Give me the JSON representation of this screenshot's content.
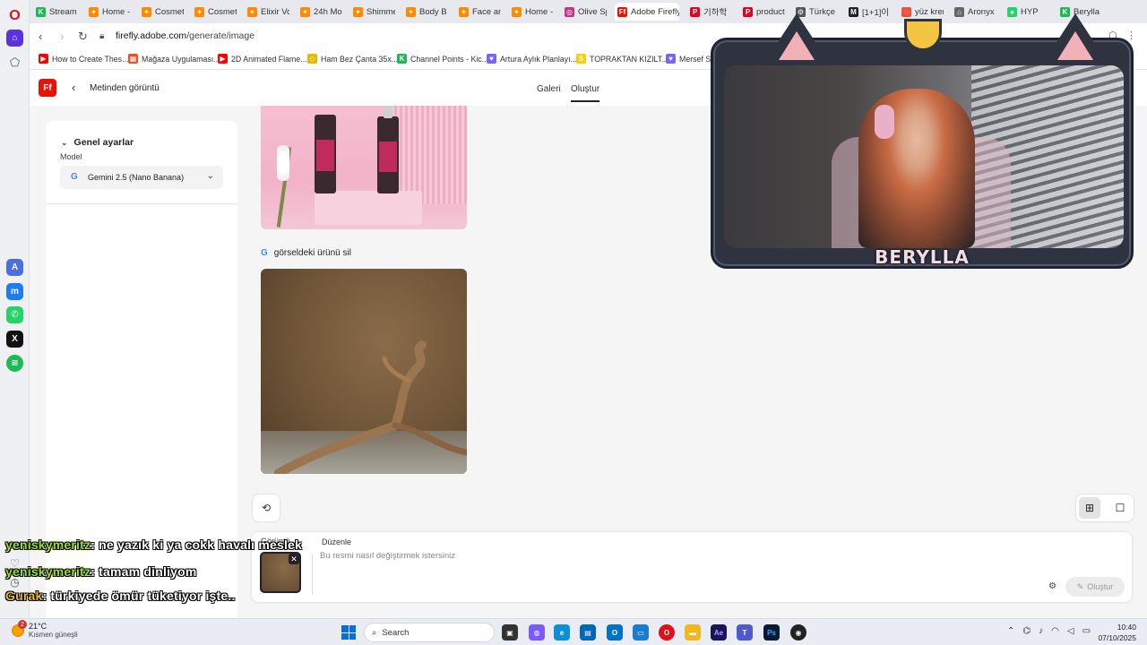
{
  "browser": {
    "url_host": "firefly.adobe.com",
    "url_path": "/generate/image",
    "tabs": [
      {
        "label": "Stream",
        "color": "#1db954",
        "icon": "K"
      },
      {
        "label": "Home -",
        "color": "#ff8a00",
        "icon": "✦"
      },
      {
        "label": "Cosmet",
        "color": "#ff8a00",
        "icon": "✦"
      },
      {
        "label": "Cosmeti",
        "color": "#ff8a00",
        "icon": "✦"
      },
      {
        "label": "Elixir Vo",
        "color": "#ff8a00",
        "icon": "✦"
      },
      {
        "label": "24h Mo",
        "color": "#ff8a00",
        "icon": "✦"
      },
      {
        "label": "Shimme",
        "color": "#ff8a00",
        "icon": "✦"
      },
      {
        "label": "Body B",
        "color": "#ff8a00",
        "icon": "✦"
      },
      {
        "label": "Face anc",
        "color": "#ff8a00",
        "icon": "✦"
      },
      {
        "label": "Home -",
        "color": "#ff8a00",
        "icon": "✦"
      },
      {
        "label": "Olive Sp",
        "color": "#c13584",
        "icon": "◎"
      },
      {
        "label": "Adobe Firefly",
        "color": "#eb1000",
        "icon": "Ff"
      },
      {
        "label": "기하학",
        "color": "#e60023",
        "icon": "P"
      },
      {
        "label": "product",
        "color": "#e60023",
        "icon": "P"
      },
      {
        "label": "Türkçe",
        "color": "#555555",
        "icon": "⚙"
      },
      {
        "label": "[1+1]이",
        "color": "#222222",
        "icon": "M"
      },
      {
        "label": "yüz krem",
        "color": "#e8533a",
        "icon": "◌"
      },
      {
        "label": "Aronyx",
        "color": "#666666",
        "icon": "⌂"
      },
      {
        "label": "HYP",
        "color": "#25d366",
        "icon": "●"
      },
      {
        "label": "Berylla",
        "color": "#1db954",
        "icon": "K"
      }
    ],
    "active_tab_index": 11,
    "bookmarks": [
      {
        "label": "How to Create Thes...",
        "color": "#ff0000",
        "icon": "▶"
      },
      {
        "label": "Mağaza Uygulaması...",
        "color": "#f25022",
        "icon": "▦"
      },
      {
        "label": "2D Animated Flame...",
        "color": "#ff0000",
        "icon": "▶"
      },
      {
        "label": "Ham Bez Çanta 35x...",
        "color": "#e6b800",
        "icon": "◇"
      },
      {
        "label": "Channel Points - Kic...",
        "color": "#1db954",
        "icon": "K"
      },
      {
        "label": "Artura Aylık Planlayı...",
        "color": "#7b61ff",
        "icon": "♥"
      },
      {
        "label": "TOPRAKTAN KIZILT...",
        "color": "#f6d000",
        "icon": "S"
      },
      {
        "label": "Mersef Sa...",
        "color": "#7b61ff",
        "icon": "♥"
      }
    ]
  },
  "app": {
    "logo_text": "Ff",
    "back_title": "Metinden görüntü",
    "nav_gallery": "Galeri",
    "nav_create": "Oluştur"
  },
  "sidebar": {
    "section_title": "Genel ayarlar",
    "model_label": "Model",
    "model_value": "Gemini 2.5 (Nano Banana)"
  },
  "feed": {
    "prompt_text": "görseldeki ürünü sil"
  },
  "composer": {
    "image_label": "Görüntü",
    "edit_label": "Düzenle",
    "placeholder": "Bu resmi nasıl değiştirmek istersiniz",
    "generate_label": "Oluştur"
  },
  "chat": [
    {
      "user": "yeniskymeritz",
      "user_color": "#9adf2b",
      "message": ": ne yazık ki ya cokk havalı meslek"
    },
    {
      "user": "yeniskymeritz",
      "user_color": "#9adf2b",
      "message": ": tamam dinliyom"
    },
    {
      "user": "Gurak",
      "user_color": "#e8b64a",
      "message": ": türkiyede ömür tüketiyor işte.."
    }
  ],
  "stream": {
    "name": "BERYLLA"
  },
  "taskbar": {
    "temperature": "21°C",
    "weather_text": "Kısmen güneşli",
    "weather_badge": "2",
    "search_label": "Search",
    "time": "10:40",
    "date": "07/10/2025"
  }
}
